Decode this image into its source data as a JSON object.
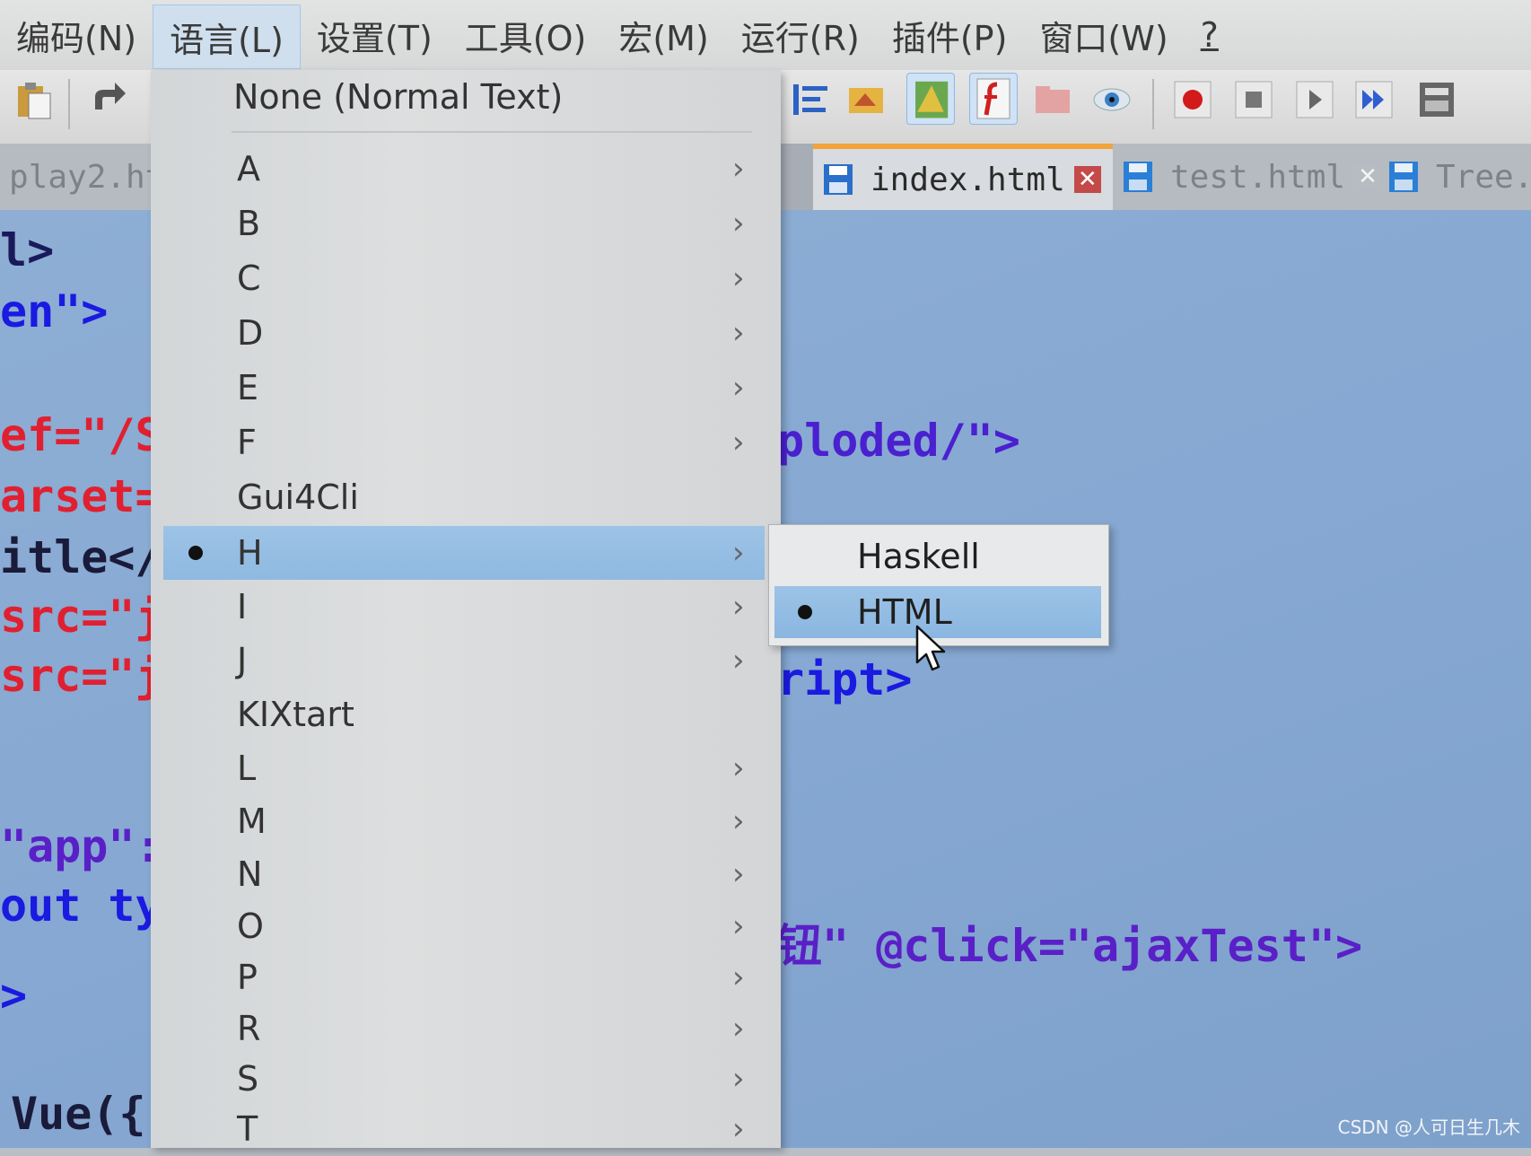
{
  "menubar": {
    "items": [
      {
        "label": "编码(N)"
      },
      {
        "label": "语言(L)"
      },
      {
        "label": "设置(T)"
      },
      {
        "label": "工具(O)"
      },
      {
        "label": "宏(M)"
      },
      {
        "label": "运行(R)"
      },
      {
        "label": "插件(P)"
      },
      {
        "label": "窗口(W)"
      },
      {
        "label": "?"
      }
    ]
  },
  "tabs": [
    {
      "label": "play2.ht"
    },
    {
      "label": "index.html",
      "close": "✕"
    },
    {
      "label": "test.html",
      "close": "✕"
    },
    {
      "label": "Tree."
    }
  ],
  "editor": {
    "left_lines": [
      "l>",
      "en\">",
      "ef=\"/S",
      "arset=",
      "itle</",
      "src=\"j",
      "src=\"j",
      "\"app\":",
      "out typ",
      ">",
      "Vue({"
    ],
    "right_lines": [
      "ploded/\">",
      "ript>",
      "钮\" @click=\"ajaxTest\">"
    ]
  },
  "language_menu": {
    "none_item": "None (Normal Text)",
    "items": [
      {
        "label": "A",
        "arrow": "›"
      },
      {
        "label": "B",
        "arrow": "›"
      },
      {
        "label": "C",
        "arrow": "›"
      },
      {
        "label": "D",
        "arrow": "›"
      },
      {
        "label": "E",
        "arrow": "›"
      },
      {
        "label": "F",
        "arrow": "›"
      },
      {
        "label": "Gui4Cli"
      },
      {
        "label": "H",
        "arrow": "›"
      },
      {
        "label": "I",
        "arrow": "›"
      },
      {
        "label": "J",
        "arrow": "›"
      },
      {
        "label": "KIXtart"
      },
      {
        "label": "L",
        "arrow": "›"
      },
      {
        "label": "M",
        "arrow": "›"
      },
      {
        "label": "N",
        "arrow": "›"
      },
      {
        "label": "O",
        "arrow": "›"
      },
      {
        "label": "P",
        "arrow": "›"
      },
      {
        "label": "R",
        "arrow": "›"
      },
      {
        "label": "S",
        "arrow": "›"
      },
      {
        "label": "T",
        "arrow": "›"
      }
    ]
  },
  "submenu": {
    "items": [
      {
        "label": "Haskell"
      },
      {
        "label": "HTML"
      }
    ]
  },
  "watermark": "CSDN @人可日生几木"
}
